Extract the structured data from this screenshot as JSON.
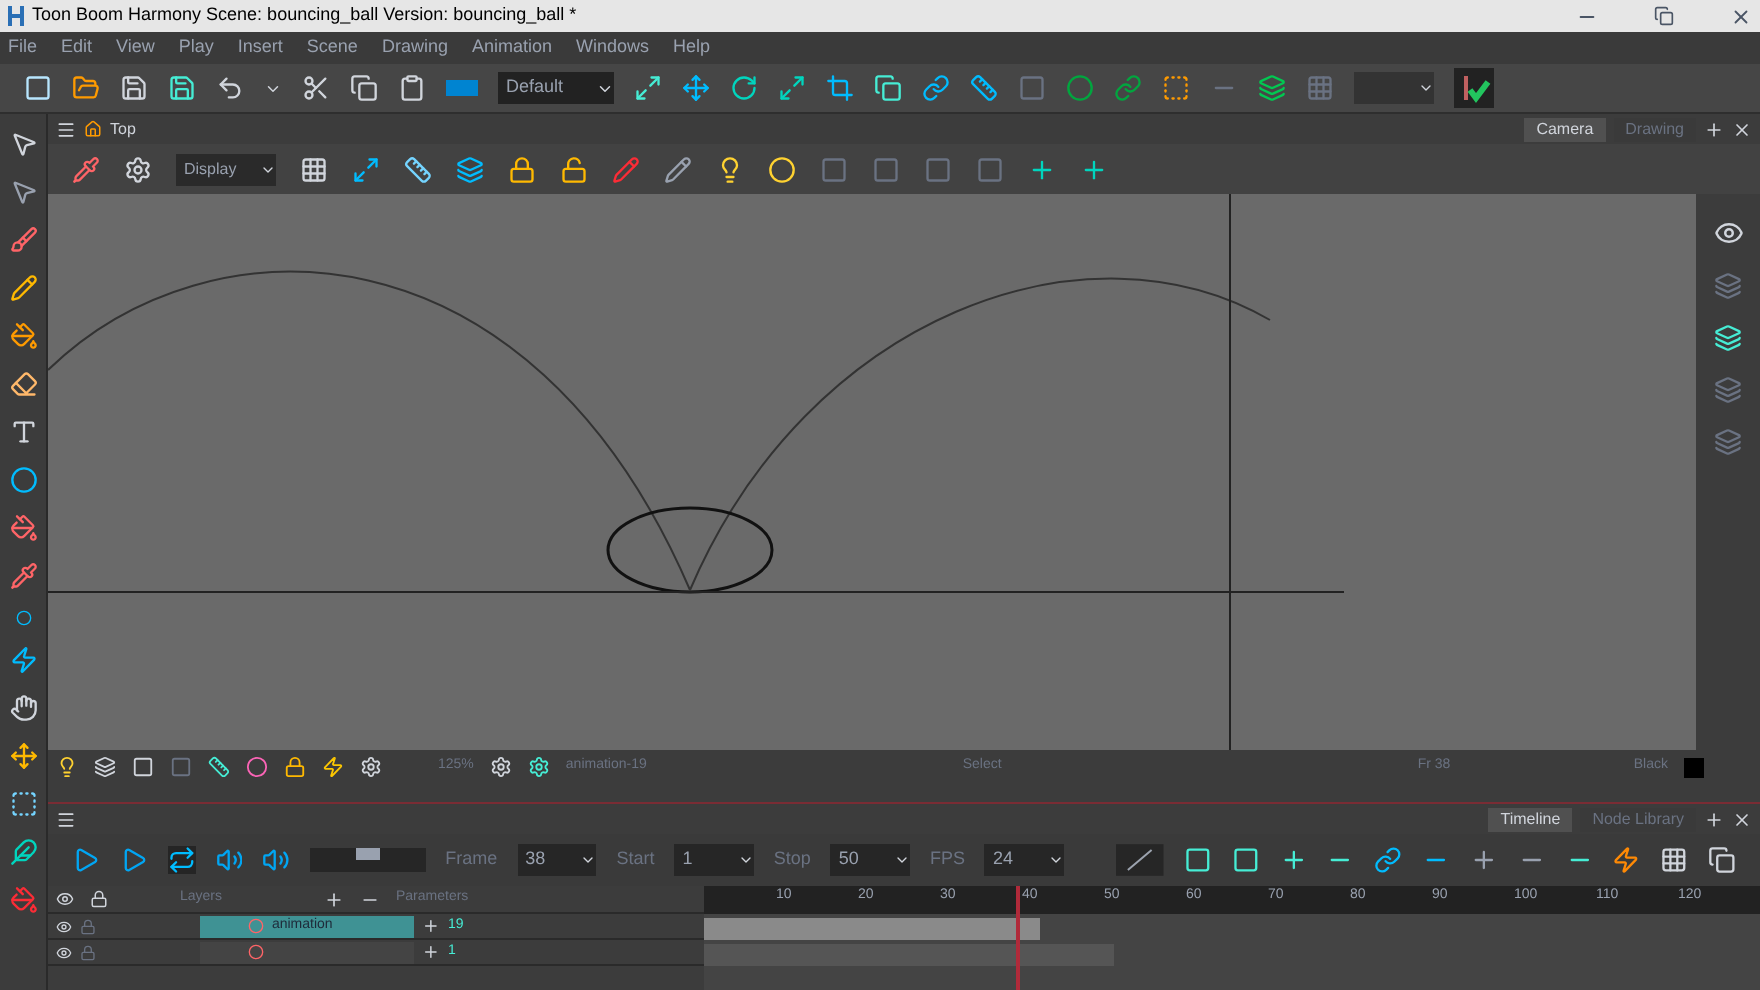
{
  "window": {
    "title": "Toon Boom Harmony Scene: bouncing_ball Version: bouncing_ball *"
  },
  "menu": [
    "File",
    "Edit",
    "View",
    "Play",
    "Insert",
    "Scene",
    "Drawing",
    "Animation",
    "Windows",
    "Help"
  ],
  "toolbar": {
    "workspace": "Default"
  },
  "view": {
    "title": "Top",
    "display": "Display",
    "tabs": [
      {
        "label": "Camera",
        "selected": true
      },
      {
        "label": "Drawing",
        "selected": false
      }
    ]
  },
  "status_bar": {
    "zoom": "125%",
    "drawing": "animation-19",
    "tool": "Select",
    "frame": "Fr 38",
    "color_name": "Black",
    "color": "#000000"
  },
  "playback": {
    "speed": {
      "level": 0.5
    }
  },
  "timeline": {
    "tabs": [
      {
        "label": "Timeline",
        "selected": true
      },
      {
        "label": "Node Library",
        "selected": false
      }
    ],
    "fields": [
      {
        "label": "Frame",
        "value": "38"
      },
      {
        "label": "Start",
        "value": "1"
      },
      {
        "label": "Stop",
        "value": "50"
      },
      {
        "label": "FPS",
        "value": "24"
      }
    ],
    "columns": {
      "layers": "Layers",
      "parameters": "Parameters"
    },
    "ruler": [
      "10",
      "20",
      "30",
      "40",
      "50",
      "60",
      "70",
      "80",
      "90",
      "100",
      "110",
      "120"
    ],
    "layers": [
      {
        "name": "animation",
        "parameter": "19",
        "selected": true
      },
      {
        "parameter": "1",
        "selected": false
      }
    ]
  }
}
